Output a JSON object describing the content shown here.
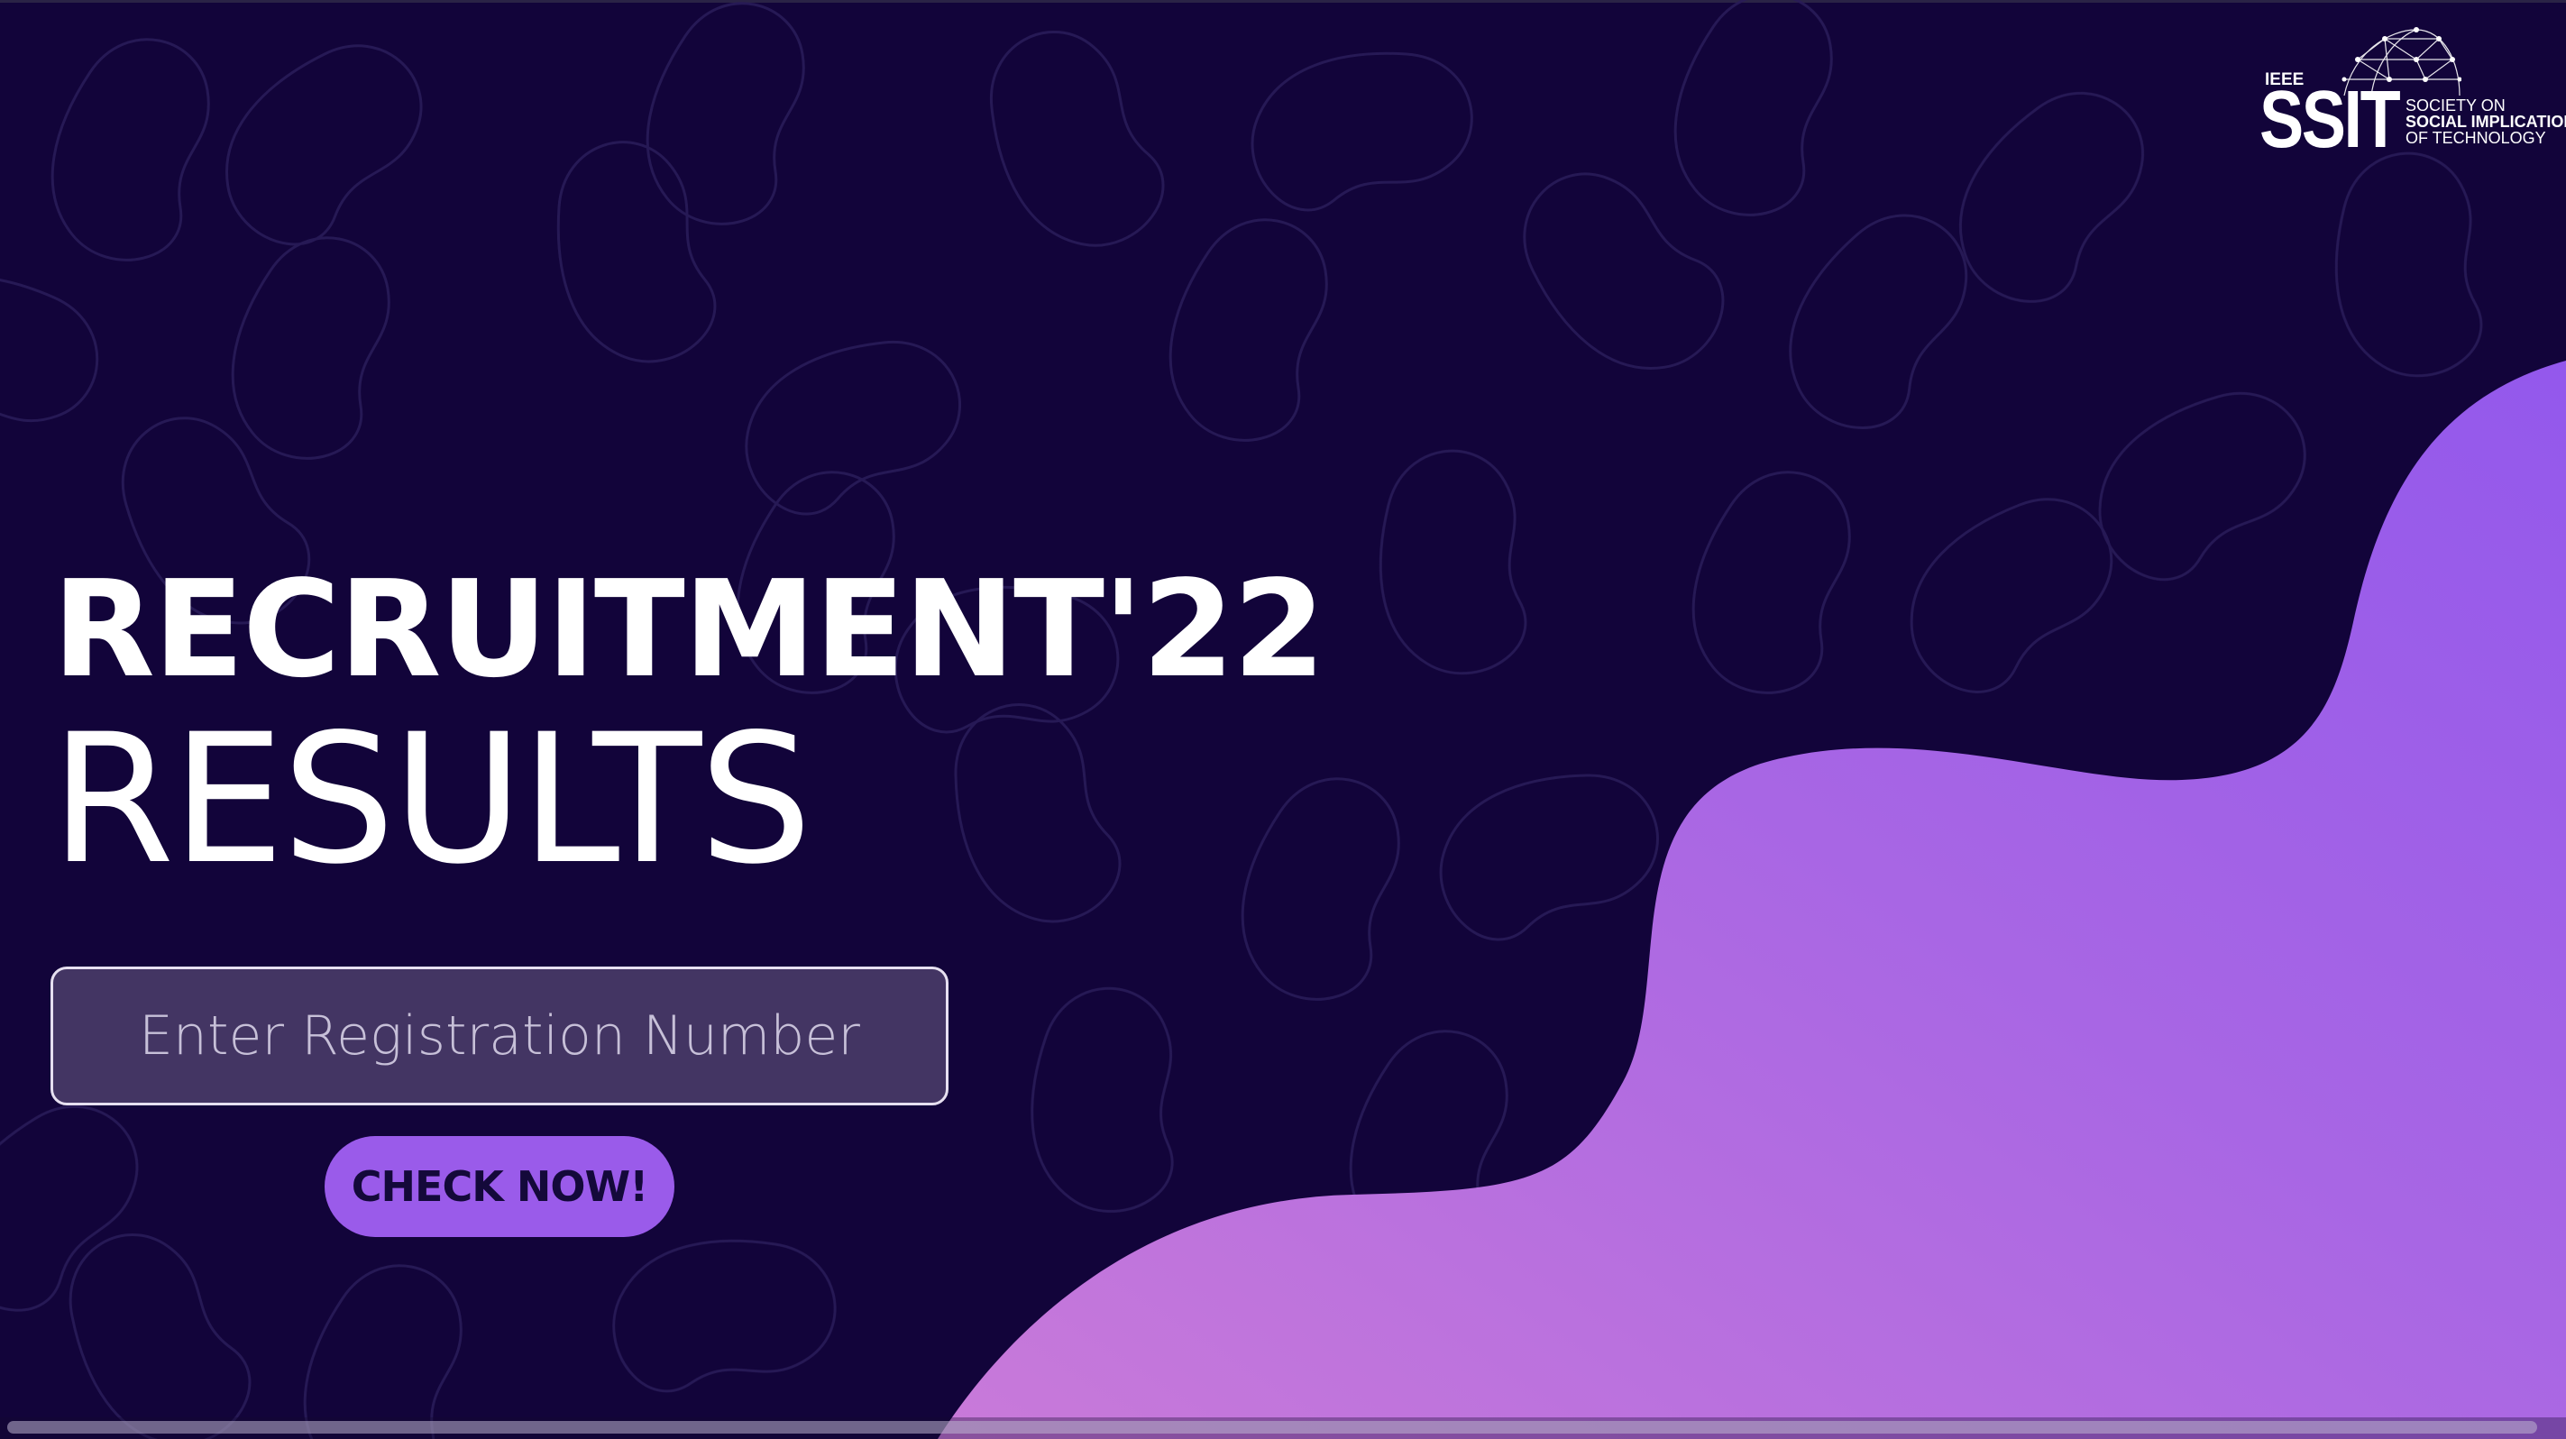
{
  "logo": {
    "ieee": "IEEE",
    "ssit": "SSIT",
    "society_line1": "SOCIETY ON",
    "society_line2": "SOCIAL IMPLICATIONS",
    "society_line3": "OF TECHNOLOGY"
  },
  "hero": {
    "title_line1": "RECRUITMENT'22",
    "title_line2": "RESULTS"
  },
  "form": {
    "registration_placeholder": "Enter Registration Number",
    "registration_value": "",
    "check_button_label": "CHECK NOW!"
  },
  "colors": {
    "background": "#12043a",
    "accent_purple": "#9a5bea",
    "wave_pink": "#c878dc",
    "input_fill": "#433563"
  }
}
